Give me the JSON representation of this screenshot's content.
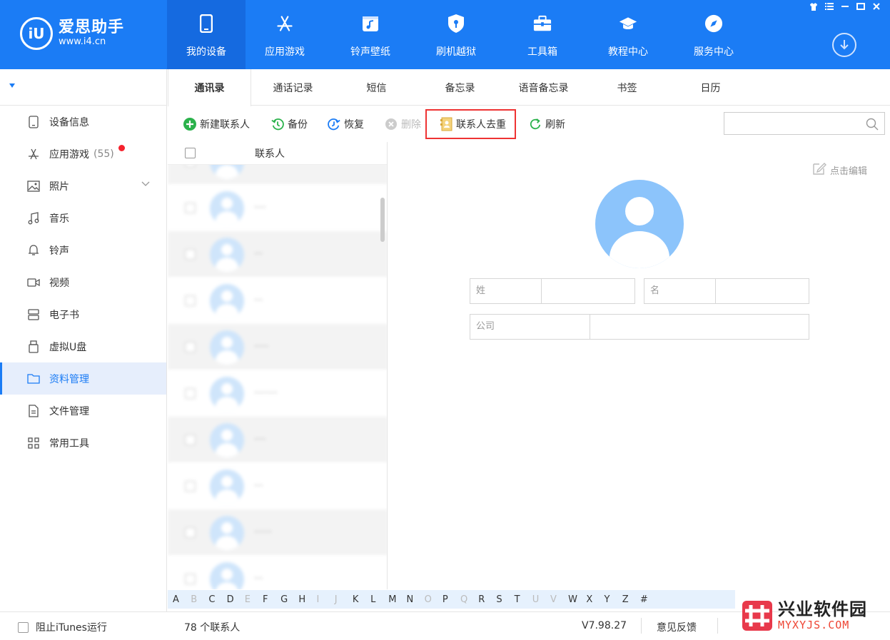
{
  "app": {
    "logo_mark": "iU",
    "logo_name": "爱思助手",
    "logo_url": "www.i4.cn"
  },
  "nav": [
    {
      "label": "我的设备",
      "icon": "phone-icon"
    },
    {
      "label": "应用游戏",
      "icon": "appstore-icon"
    },
    {
      "label": "铃声壁纸",
      "icon": "music-wallpaper-icon"
    },
    {
      "label": "刷机越狱",
      "icon": "shield-icon"
    },
    {
      "label": "工具箱",
      "icon": "toolbox-icon"
    },
    {
      "label": "教程中心",
      "icon": "graduation-cap-icon"
    },
    {
      "label": "服务中心",
      "icon": "compass-icon"
    }
  ],
  "sidebar": {
    "items": [
      {
        "label": "设备信息",
        "icon": "device-info-icon"
      },
      {
        "label": "应用游戏",
        "suffix": "(55)",
        "icon": "appstore-icon"
      },
      {
        "label": "照片",
        "icon": "photo-icon"
      },
      {
        "label": "音乐",
        "icon": "music-icon"
      },
      {
        "label": "铃声",
        "icon": "bell-icon"
      },
      {
        "label": "视频",
        "icon": "video-icon"
      },
      {
        "label": "电子书",
        "icon": "ebook-icon"
      },
      {
        "label": "虚拟U盘",
        "icon": "usb-drive-icon"
      },
      {
        "label": "资料管理",
        "icon": "folder-icon"
      },
      {
        "label": "文件管理",
        "icon": "file-icon"
      },
      {
        "label": "常用工具",
        "icon": "grid-icon"
      }
    ]
  },
  "tabs": [
    "通讯录",
    "通话记录",
    "短信",
    "备忘录",
    "语音备忘录",
    "书签",
    "日历"
  ],
  "toolbar": {
    "new_contact": "新建联系人",
    "backup": "备份",
    "restore": "恢复",
    "delete": "删除",
    "dedup": "联系人去重",
    "refresh": "刷新",
    "search_value": ""
  },
  "list": {
    "header": "联系人",
    "rows": [
      {
        "name": "·········"
      },
      {
        "name": "····"
      },
      {
        "name": "···"
      },
      {
        "name": "···"
      },
      {
        "name": "·····"
      },
      {
        "name": "········"
      },
      {
        "name": "····"
      },
      {
        "name": "···"
      },
      {
        "name": "······"
      },
      {
        "name": "···"
      }
    ]
  },
  "alphabet": [
    {
      "l": "A",
      "dim": false
    },
    {
      "l": "B",
      "dim": true
    },
    {
      "l": "C",
      "dim": false
    },
    {
      "l": "D",
      "dim": false
    },
    {
      "l": "E",
      "dim": true
    },
    {
      "l": "F",
      "dim": false
    },
    {
      "l": "G",
      "dim": false
    },
    {
      "l": "H",
      "dim": false
    },
    {
      "l": "I",
      "dim": true
    },
    {
      "l": "J",
      "dim": true
    },
    {
      "l": "K",
      "dim": false
    },
    {
      "l": "L",
      "dim": false
    },
    {
      "l": "M",
      "dim": false
    },
    {
      "l": "N",
      "dim": false
    },
    {
      "l": "O",
      "dim": true
    },
    {
      "l": "P",
      "dim": false
    },
    {
      "l": "Q",
      "dim": true
    },
    {
      "l": "R",
      "dim": false
    },
    {
      "l": "S",
      "dim": false
    },
    {
      "l": "T",
      "dim": false
    },
    {
      "l": "U",
      "dim": true
    },
    {
      "l": "V",
      "dim": true
    },
    {
      "l": "W",
      "dim": false
    },
    {
      "l": "X",
      "dim": false
    },
    {
      "l": "Y",
      "dim": false
    },
    {
      "l": "Z",
      "dim": false
    },
    {
      "l": "#",
      "dim": false
    }
  ],
  "detail": {
    "edit": "点击编辑",
    "surname_label": "姓",
    "given_label": "名",
    "company_label": "公司"
  },
  "status": {
    "itunes_block": "阻止iTunes运行",
    "contact_count": "78 个联系人",
    "version": "V7.98.27",
    "feedback": "意见反馈"
  },
  "watermark": {
    "name": "兴业软件园",
    "url": "MYXYJS.COM"
  },
  "colors": {
    "brand_blue": "#1b7cf5",
    "avatar_blue": "#8cc4fb",
    "highlight_red": "#e33"
  }
}
